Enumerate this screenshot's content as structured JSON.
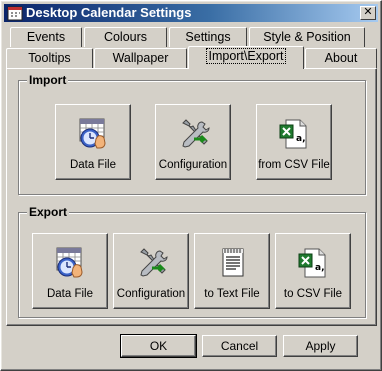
{
  "window": {
    "title": "Desktop Calendar Settings",
    "close_glyph": "✕"
  },
  "tabs": {
    "row1": [
      {
        "label": "Events"
      },
      {
        "label": "Colours"
      },
      {
        "label": "Settings"
      },
      {
        "label": "Style & Position"
      }
    ],
    "row2": [
      {
        "label": "Tooltips"
      },
      {
        "label": "Wallpaper"
      },
      {
        "label": "Import\\Export",
        "active": true
      },
      {
        "label": "About"
      }
    ]
  },
  "import": {
    "title": "Import",
    "buttons": [
      {
        "label": "Data File",
        "icon": "calendar-clock-icon"
      },
      {
        "label": "Configuration",
        "icon": "tools-icon"
      },
      {
        "label": "from CSV File",
        "icon": "excel-csv-icon"
      }
    ]
  },
  "export": {
    "title": "Export",
    "buttons": [
      {
        "label": "Data File",
        "icon": "calendar-clock-icon"
      },
      {
        "label": "Configuration",
        "icon": "tools-icon"
      },
      {
        "label": "to Text File",
        "icon": "text-file-icon"
      },
      {
        "label": "to CSV File",
        "icon": "excel-csv-icon"
      }
    ]
  },
  "footer": {
    "ok": "OK",
    "cancel": "Cancel",
    "apply": "Apply"
  },
  "colors": {
    "title_start": "#0a246a",
    "title_end": "#a6caf0",
    "face": "#d4d0c8"
  }
}
